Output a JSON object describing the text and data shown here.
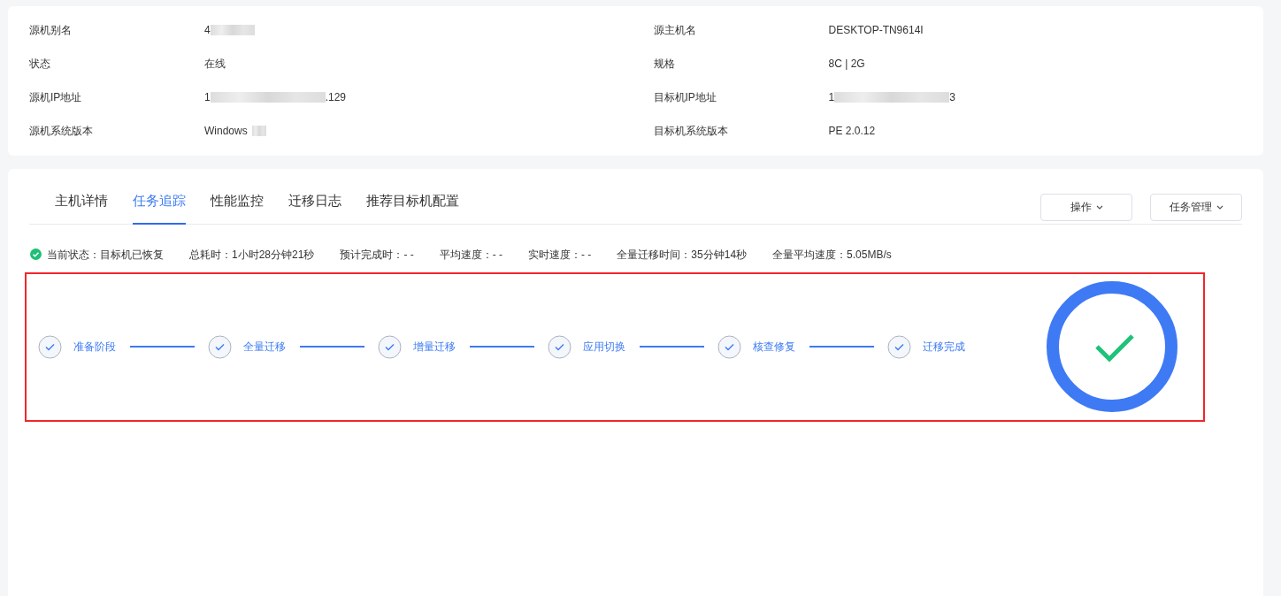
{
  "info": {
    "rows": [
      {
        "label": "源机别名",
        "value": "4",
        "redacted": true
      },
      {
        "label": "源主机名",
        "value": "DESKTOP-TN9614I"
      },
      {
        "label": "状态",
        "value": "在线"
      },
      {
        "label": "规格",
        "value": "8C | 2G"
      },
      {
        "label": "源机IP地址",
        "value": "1",
        "suffix": ".129",
        "redacted": true
      },
      {
        "label": "目标机IP地址",
        "value": "1",
        "suffix": "3",
        "redacted": true
      },
      {
        "label": "源机系统版本",
        "value": "Windows",
        "redacted": true
      },
      {
        "label": "目标机系统版本",
        "value": "PE 2.0.12"
      }
    ]
  },
  "tabs": [
    {
      "label": "主机详情",
      "selected": false
    },
    {
      "label": "任务追踪",
      "selected": true
    },
    {
      "label": "性能监控",
      "selected": false
    },
    {
      "label": "迁移日志",
      "selected": false
    },
    {
      "label": "推荐目标机配置",
      "selected": false
    }
  ],
  "actions": [
    "操作",
    "任务管理"
  ],
  "status": {
    "ok": true,
    "items": [
      "当前状态：目标机已恢复",
      "总耗时：1小时28分钟21秒",
      "预计完成时：- -",
      "平均速度：- -",
      "实时速度：- -",
      "全量迁移时间：35分钟14秒",
      "全量平均速度：5.05MB/s"
    ]
  },
  "steps": [
    {
      "label": "准备阶段",
      "done": true
    },
    {
      "label": "全量迁移",
      "done": true
    },
    {
      "label": "增量迁移",
      "done": true
    },
    {
      "label": "应用切换",
      "done": true
    },
    {
      "label": "核查修复",
      "done": true
    },
    {
      "label": "迁移完成",
      "done": true
    }
  ],
  "result": {
    "complete": true
  }
}
